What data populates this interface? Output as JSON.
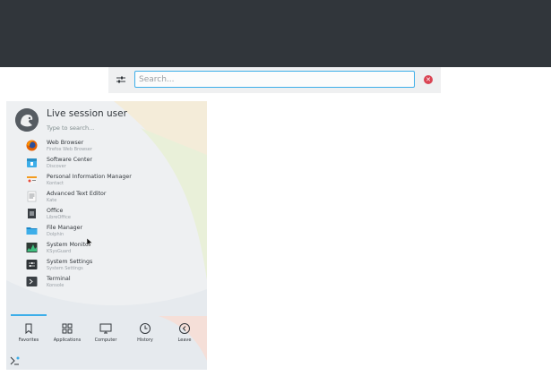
{
  "search": {
    "placeholder": "Search...",
    "clear_icon": "clear-icon"
  },
  "launcher": {
    "user": "Live session user",
    "search_hint": "Type to search...",
    "favorites": [
      {
        "name": "Web Browser",
        "desc": "Firefox Web Browser",
        "icon": "firefox-icon",
        "color": "#e66000"
      },
      {
        "name": "Software Center",
        "desc": "Discover",
        "icon": "software-center-icon",
        "color": "#3daee9"
      },
      {
        "name": "Personal Information Manager",
        "desc": "Kontact",
        "icon": "kontact-icon",
        "color": "#f39c1f"
      },
      {
        "name": "Advanced Text Editor",
        "desc": "Kate",
        "icon": "text-editor-icon",
        "color": "#eceff1"
      },
      {
        "name": "Office",
        "desc": "LibreOffice",
        "icon": "office-icon",
        "color": "#3a3f44"
      },
      {
        "name": "File Manager",
        "desc": "Dolphin",
        "icon": "folder-icon",
        "color": "#2d9fd8"
      },
      {
        "name": "System Monitor",
        "desc": "KSysGuard",
        "icon": "system-monitor-icon",
        "color": "#4d6b5a"
      },
      {
        "name": "System Settings",
        "desc": "System Settings",
        "icon": "settings-icon",
        "color": "#2f3337"
      },
      {
        "name": "Terminal",
        "desc": "Konsole",
        "icon": "terminal-icon",
        "color": "#3b4045"
      }
    ],
    "tabs": [
      {
        "label": "Favorites",
        "icon": "bookmark-icon"
      },
      {
        "label": "Applications",
        "icon": "grid-icon"
      },
      {
        "label": "Computer",
        "icon": "monitor-icon"
      },
      {
        "label": "History",
        "icon": "clock-icon"
      },
      {
        "label": "Leave",
        "icon": "back-arrow-icon"
      }
    ]
  },
  "colors": {
    "panel": "#31363b",
    "accent": "#3daee9",
    "clear": "#da4453"
  }
}
